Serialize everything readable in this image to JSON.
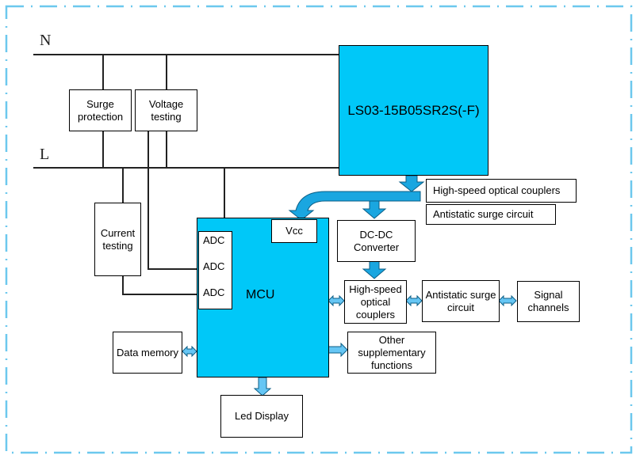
{
  "lines": {
    "neutral": "N",
    "live": "L"
  },
  "blocks": {
    "power_module": "LS03-15B05SR2S(-F)",
    "surge_protection": "Surge protection",
    "voltage_testing": "Voltage testing",
    "current_testing": "Current testing",
    "mcu": "MCU",
    "vcc": "Vcc",
    "adc": [
      "ADC",
      "ADC",
      "ADC"
    ],
    "dcdc": "DC-DC Converter",
    "hs_coupler_label": "High-speed optical couplers",
    "antistatic_label": "Antistatic surge circuit",
    "hs_coupler": "High-speed optical couplers",
    "antistatic": "Antistatic surge circuit",
    "signal_channels": "Signal channels",
    "data_memory": "Data memory",
    "other_functions": "Other supplementary functions",
    "led_display": "Led Display"
  },
  "colors": {
    "accent": "#00c8f8",
    "arrow": "#1aa6e0",
    "arrow_light": "#66c6f4",
    "frame": "#6cc8ee"
  }
}
